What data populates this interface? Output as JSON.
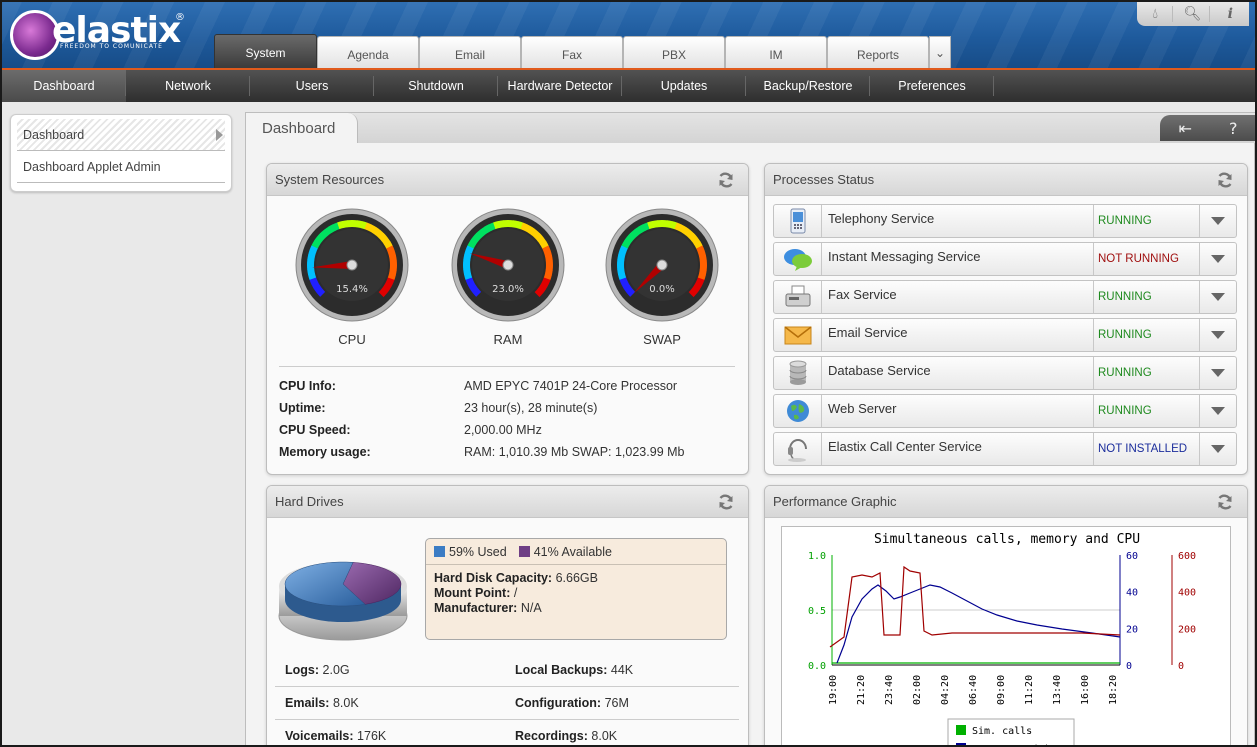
{
  "brand": {
    "name": "elastix",
    "tagline": "FREEDOM TO COMUNICATE",
    "reg": "®"
  },
  "top_tabs": [
    {
      "label": "System",
      "active": true
    },
    {
      "label": "Agenda"
    },
    {
      "label": "Email"
    },
    {
      "label": "Fax"
    },
    {
      "label": "PBX"
    },
    {
      "label": "IM"
    },
    {
      "label": "Reports"
    }
  ],
  "top_icons": [
    "drop-icon",
    "search-icon",
    "info-icon"
  ],
  "sub_nav": [
    {
      "label": "Dashboard",
      "active": true
    },
    {
      "label": "Network"
    },
    {
      "label": "Users"
    },
    {
      "label": "Shutdown"
    },
    {
      "label": "Hardware Detector"
    },
    {
      "label": "Updates"
    },
    {
      "label": "Backup/Restore"
    },
    {
      "label": "Preferences"
    }
  ],
  "left_menu": [
    {
      "label": "Dashboard",
      "active": true
    },
    {
      "label": "Dashboard Applet Admin"
    }
  ],
  "content": {
    "tab": "Dashboard",
    "help": "?"
  },
  "system_resources": {
    "title": "System Resources",
    "gauges": [
      {
        "label": "CPU",
        "value_text": "15.4%",
        "value": 15.4
      },
      {
        "label": "RAM",
        "value_text": "23.0%",
        "value": 23.0
      },
      {
        "label": "SWAP",
        "value_text": "0.0%",
        "value": 0.0
      }
    ],
    "info": [
      {
        "key": "CPU Info:",
        "value": "AMD EPYC 7401P 24-Core Processor"
      },
      {
        "key": "Uptime:",
        "value": "23 hour(s), 28 minute(s)"
      },
      {
        "key": "CPU Speed:",
        "value": "2,000.00 MHz"
      },
      {
        "key": "Memory usage:",
        "value": "RAM: 1,010.39 Mb SWAP: 1,023.99 Mb"
      }
    ]
  },
  "processes": {
    "title": "Processes Status",
    "items": [
      {
        "name": "Telephony Service",
        "status": "RUNNING",
        "state": "running",
        "icon": "phone-icon"
      },
      {
        "name": "Instant Messaging Service",
        "status": "NOT RUNNING",
        "state": "notrunning",
        "icon": "chat-icon"
      },
      {
        "name": "Fax Service",
        "status": "RUNNING",
        "state": "running",
        "icon": "fax-icon"
      },
      {
        "name": "Email Service",
        "status": "RUNNING",
        "state": "running",
        "icon": "envelope-icon"
      },
      {
        "name": "Database Service",
        "status": "RUNNING",
        "state": "running",
        "icon": "database-icon"
      },
      {
        "name": "Web Server",
        "status": "RUNNING",
        "state": "running",
        "icon": "globe-icon"
      },
      {
        "name": "Elastix Call Center Service",
        "status": "NOT INSTALLED",
        "state": "notinst",
        "icon": "headset-icon"
      }
    ]
  },
  "hard_drives": {
    "title": "Hard Drives",
    "used_pct": 59,
    "legend_used": "59% Used",
    "legend_available": "41% Available",
    "capacity_label": "Hard Disk Capacity:",
    "capacity_value": "6.66GB",
    "mount_label": "Mount Point:",
    "mount_value": "/",
    "manufacturer_label": "Manufacturer:",
    "manufacturer_value": "N/A",
    "stats": [
      [
        {
          "k": "Logs:",
          "v": "2.0G"
        },
        {
          "k": "Local Backups:",
          "v": "44K"
        }
      ],
      [
        {
          "k": "Emails:",
          "v": "8.0K"
        },
        {
          "k": "Configuration:",
          "v": "76M"
        }
      ],
      [
        {
          "k": "Voicemails:",
          "v": "176K"
        },
        {
          "k": "Recordings:",
          "v": "8.0K"
        }
      ]
    ],
    "colors": {
      "used": "#3b7cc4",
      "available": "#6f3f85"
    }
  },
  "performance": {
    "title": "Performance Graphic",
    "chart_data": {
      "type": "line",
      "title": "Simultaneous calls, memory and CPU",
      "x": [
        "19:00",
        "21:20",
        "23:40",
        "02:00",
        "04:20",
        "06:40",
        "09:00",
        "11:20",
        "13:40",
        "16:00",
        "18:20"
      ],
      "y_left_ticks": [
        "1.0",
        "0.5",
        "0.0"
      ],
      "y_mid_ticks": [
        "60",
        "40",
        "20",
        "0"
      ],
      "y_right_ticks": [
        "600",
        "400",
        "200",
        "0"
      ],
      "legend": [
        "Sim. calls",
        "CPU usage (%)"
      ],
      "series": [
        {
          "name": "Sim. calls",
          "color": "#00b000"
        },
        {
          "name": "CPU usage (%)",
          "color": "#000090"
        },
        {
          "color": "#a00000"
        }
      ]
    }
  }
}
